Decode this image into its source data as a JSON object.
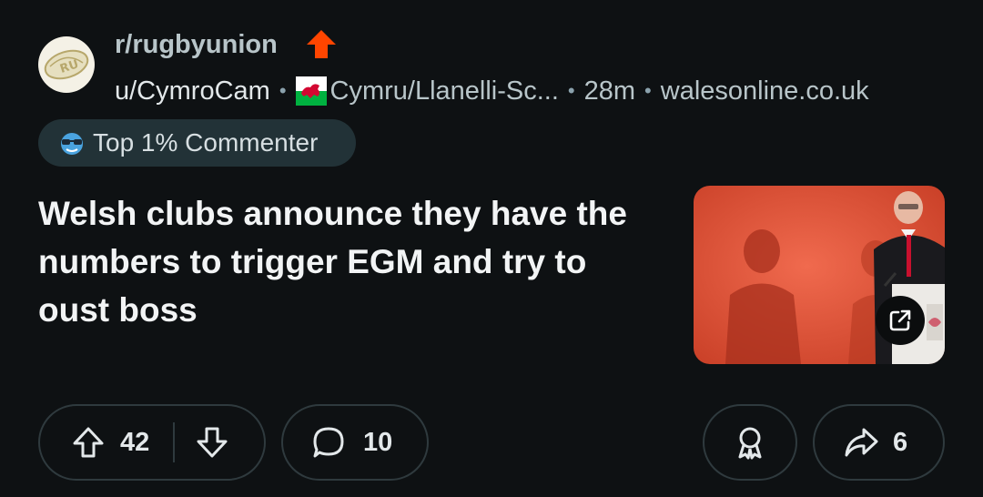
{
  "post": {
    "subreddit": "r/rugbyunion",
    "author": "u/CymroCam",
    "flair_text": "Cymru/Llanelli-Sc...",
    "time": "28m",
    "domain": "walesonline.co.uk",
    "badge": "Top 1% Commenter",
    "title": "Welsh clubs announce they have the numbers to trigger EGM and try to oust boss"
  },
  "actions": {
    "upvotes": "42",
    "comments": "10",
    "shares": "6"
  },
  "icons": {
    "avatar": "rugby-ball-icon",
    "trend": "up-arrow-icon",
    "flag": "wales-flag-icon",
    "badge": "sunglasses-icon",
    "external": "external-link-icon",
    "upvote": "arrow-up-icon",
    "downvote": "arrow-down-icon",
    "comment": "speech-bubble-icon",
    "award": "award-icon",
    "share": "share-arrow-icon"
  },
  "colors": {
    "background": "#0e1113",
    "accent_orange": "#ff4500",
    "badge_bg": "#223237",
    "border": "#2f3a3e"
  }
}
